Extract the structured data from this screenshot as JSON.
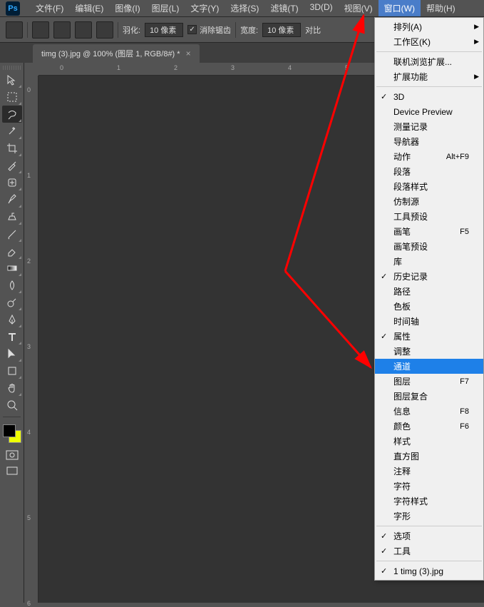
{
  "app": {
    "logo": "Ps"
  },
  "menubar": [
    {
      "label": "文件(F)"
    },
    {
      "label": "编辑(E)"
    },
    {
      "label": "图像(I)"
    },
    {
      "label": "图层(L)"
    },
    {
      "label": "文字(Y)"
    },
    {
      "label": "选择(S)"
    },
    {
      "label": "滤镜(T)"
    },
    {
      "label": "3D(D)"
    },
    {
      "label": "视图(V)"
    },
    {
      "label": "窗口(W)",
      "active": true
    },
    {
      "label": "帮助(H)"
    }
  ],
  "options": {
    "feather_label": "羽化:",
    "feather_value": "10 像素",
    "antialias_label": "消除锯齿",
    "width_label": "宽度:",
    "width_value": "10 像素",
    "contrast_label": "对比"
  },
  "tab": {
    "title": "timg (3).jpg @ 100% (图层 1, RGB/8#) *",
    "close": "×"
  },
  "ruler_h": [
    "0",
    "1",
    "2",
    "3",
    "4",
    "5"
  ],
  "ruler_v": [
    "0",
    "1",
    "2",
    "3",
    "4",
    "5",
    "6"
  ],
  "dropdown": {
    "groups": [
      [
        {
          "label": "排列(A)",
          "arrow": true
        },
        {
          "label": "工作区(K)",
          "arrow": true
        }
      ],
      [
        {
          "label": "联机浏览扩展..."
        },
        {
          "label": "扩展功能",
          "arrow": true
        }
      ],
      [
        {
          "label": "3D",
          "check": true
        },
        {
          "label": "Device Preview"
        },
        {
          "label": "测量记录"
        },
        {
          "label": "导航器"
        },
        {
          "label": "动作",
          "shortcut": "Alt+F9"
        },
        {
          "label": "段落"
        },
        {
          "label": "段落样式"
        },
        {
          "label": "仿制源"
        },
        {
          "label": "工具预设"
        },
        {
          "label": "画笔",
          "shortcut": "F5"
        },
        {
          "label": "画笔预设"
        },
        {
          "label": "库"
        },
        {
          "label": "历史记录",
          "check": true
        },
        {
          "label": "路径"
        },
        {
          "label": "色板"
        },
        {
          "label": "时间轴"
        },
        {
          "label": "属性",
          "check": true
        },
        {
          "label": "调整"
        },
        {
          "label": "通道",
          "highlighted": true
        },
        {
          "label": "图层",
          "shortcut": "F7"
        },
        {
          "label": "图层复合"
        },
        {
          "label": "信息",
          "shortcut": "F8"
        },
        {
          "label": "颜色",
          "shortcut": "F6"
        },
        {
          "label": "样式"
        },
        {
          "label": "直方图"
        },
        {
          "label": "注释"
        },
        {
          "label": "字符"
        },
        {
          "label": "字符样式"
        },
        {
          "label": "字形"
        }
      ],
      [
        {
          "label": "选项",
          "check": true
        },
        {
          "label": "工具",
          "check": true
        }
      ],
      [
        {
          "label": "1 timg (3).jpg",
          "check": true
        }
      ]
    ]
  }
}
